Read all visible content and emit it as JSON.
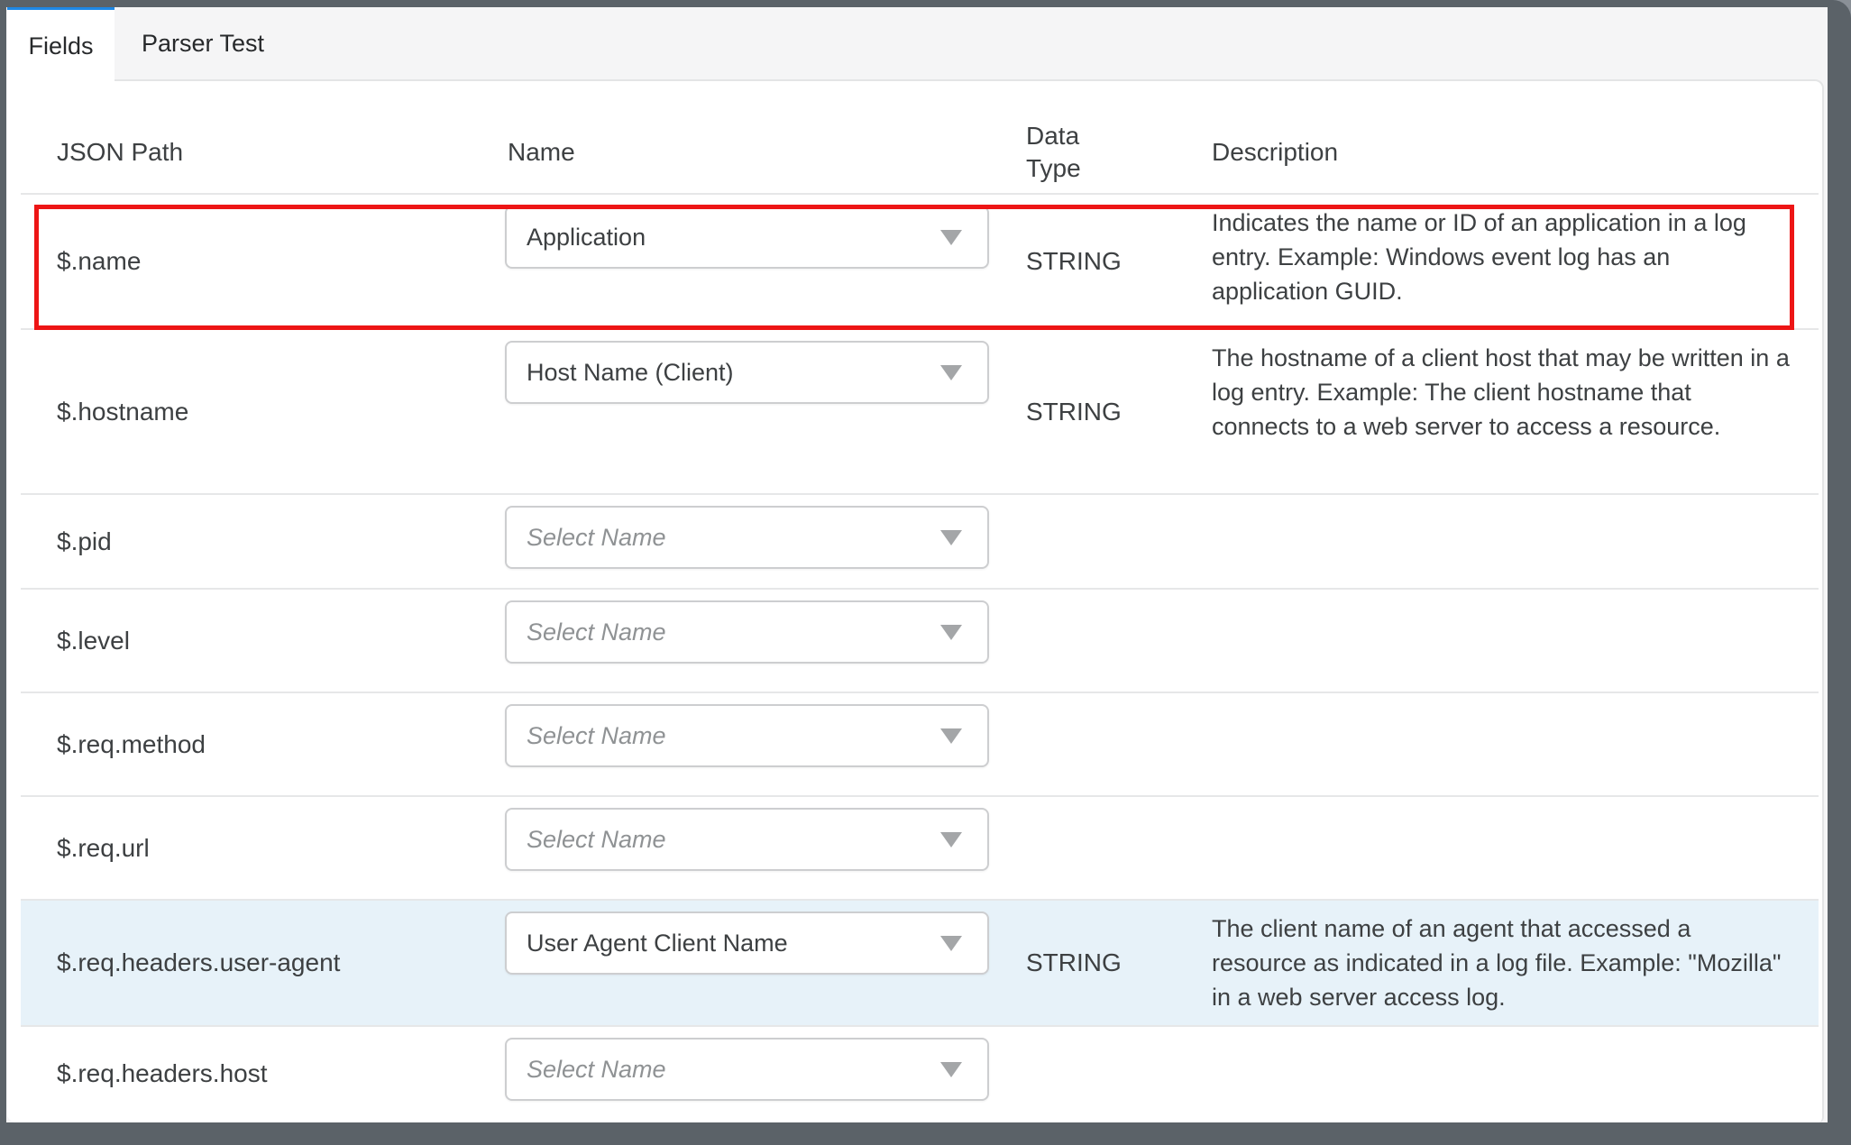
{
  "tabs": [
    {
      "label": "Fields",
      "active": true
    },
    {
      "label": "Parser Test",
      "active": false
    }
  ],
  "table": {
    "headers": {
      "json_path": "JSON Path",
      "name": "Name",
      "data_type": "Data Type",
      "description": "Description"
    },
    "select_placeholder": "Select Name",
    "rows": [
      {
        "json_path": "$.name",
        "name_value": "Application",
        "data_type": "STRING",
        "description": "Indicates the name or ID of an application in a log entry. Example: Windows event log has an application GUID.",
        "highlight": "red-border"
      },
      {
        "json_path": "$.hostname",
        "name_value": "Host Name (Client)",
        "data_type": "STRING",
        "description": "The hostname of a client host that may be written in a log entry. Example: The client hostname that connects to a web server to access a resource.",
        "highlight": "none"
      },
      {
        "json_path": "$.pid",
        "name_value": "",
        "data_type": "",
        "description": "",
        "highlight": "none"
      },
      {
        "json_path": "$.level",
        "name_value": "",
        "data_type": "",
        "description": "",
        "highlight": "none"
      },
      {
        "json_path": "$.req.method",
        "name_value": "",
        "data_type": "",
        "description": "",
        "highlight": "none"
      },
      {
        "json_path": "$.req.url",
        "name_value": "",
        "data_type": "",
        "description": "",
        "highlight": "none"
      },
      {
        "json_path": "$.req.headers.user-agent",
        "name_value": "User Agent Client Name",
        "data_type": "STRING",
        "description": "The client name of an agent that accessed a resource as indicated in a log file. Example: \"Mozilla\" in a web server access log.",
        "highlight": "selected"
      },
      {
        "json_path": "$.req.headers.host",
        "name_value": "",
        "data_type": "",
        "description": "",
        "highlight": "none"
      }
    ]
  },
  "icons": {
    "dropdown_arrow": "chevron-down"
  },
  "colors": {
    "active_tab_accent": "#1e88e5",
    "highlight_border": "#ed1515",
    "selected_row_bg": "#e7f2f9",
    "frame": "#5b6268"
  }
}
